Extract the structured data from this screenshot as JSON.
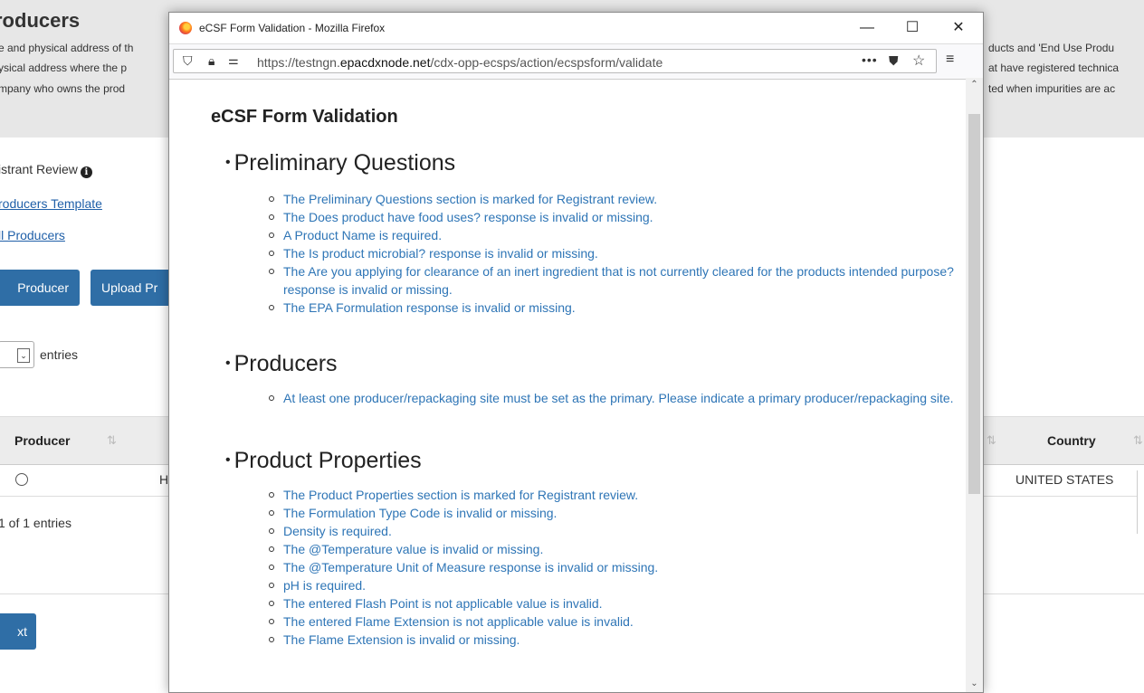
{
  "background": {
    "title": "roducers",
    "header_lines": [
      "e and physical address of th",
      "ysical address where the p",
      "mpany who owns the prod"
    ],
    "header_lines_right": [
      "ducts and 'End Use Produ",
      "at have registered technica",
      "ted when impurities are ac"
    ],
    "registrant_review": "istrant Review",
    "producers_template_link": "roducers Template",
    "all_producers_link": "ll Producers",
    "add_producer_button": "Producer",
    "upload_button": "Upload Pr",
    "entries_label": "entries",
    "table": {
      "col_producer": "Producer",
      "col_country": "Country",
      "row_h": "H",
      "row_country": "UNITED STATES"
    },
    "paging_info": "1 of 1 entries",
    "next_button": "xt"
  },
  "window": {
    "title": "eCSF Form Validation - Mozilla Firefox",
    "url_prefix": "https://testngn.",
    "url_domain": "epacdxnode.net",
    "url_path": "/cdx-opp-ecsps/action/ecspsform/validate",
    "more_icon": "•••",
    "minimize": "—",
    "maximize": "☐",
    "close": "✕"
  },
  "content": {
    "page_title": "eCSF Form Validation",
    "sections": [
      {
        "heading": "Preliminary Questions",
        "items": [
          "The Preliminary Questions section is marked for Registrant review.",
          "The Does product have food uses? response is invalid or missing.",
          "A Product Name is required.",
          "The Is product microbial? response is invalid or missing.",
          "The Are you applying for clearance of an inert ingredient that is not currently cleared for the products intended purpose? response is invalid or missing.",
          "The EPA Formulation response is invalid or missing."
        ]
      },
      {
        "heading": "Producers",
        "items": [
          "At least one producer/repackaging site must be set as the primary. Please indicate a primary producer/repackaging site."
        ]
      },
      {
        "heading": "Product Properties",
        "items": [
          "The Product Properties section is marked for Registrant review.",
          "The Formulation Type Code is invalid or missing.",
          "Density is required.",
          "The @Temperature value is invalid or missing.",
          "The @Temperature Unit of Measure response is invalid or missing.",
          "pH is required.",
          "The entered Flash Point is not applicable value is invalid.",
          "The entered Flame Extension is not applicable value is invalid.",
          "The Flame Extension is invalid or missing."
        ]
      }
    ]
  }
}
